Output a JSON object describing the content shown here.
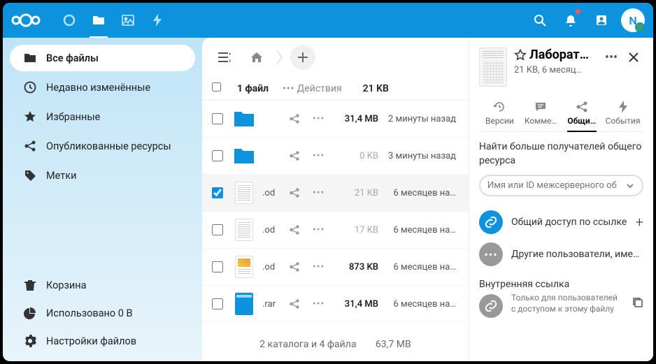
{
  "topbar": {
    "avatar_letter": "N"
  },
  "sidebar": {
    "items": [
      {
        "label": "Все файлы"
      },
      {
        "label": "Недавно изменённые"
      },
      {
        "label": "Избранные"
      },
      {
        "label": "Опубликованные ресурсы"
      },
      {
        "label": "Метки"
      }
    ],
    "trash": "Корзина",
    "quota": "Использовано 0 B",
    "settings": "Настройки файлов"
  },
  "header": {
    "count": "1 файл",
    "actions": "Действия",
    "size": "21 KB"
  },
  "files": [
    {
      "name": "",
      "ext": "",
      "size": "31,4 MB",
      "date": "2 минуты назад",
      "selected": false,
      "type": "folder",
      "dim": false
    },
    {
      "name": "",
      "ext": "",
      "size": "0 KB",
      "date": "3 минуты назад",
      "selected": false,
      "type": "folder",
      "dim": true
    },
    {
      "name": "",
      "ext": ".od",
      "size": "21 KB",
      "date": "6 месяцев на…",
      "selected": true,
      "type": "doc",
      "dim": true
    },
    {
      "name": "",
      "ext": ".od",
      "size": "17 KB",
      "date": "6 месяцев на…",
      "selected": false,
      "type": "doc",
      "dim": true
    },
    {
      "name": "",
      "ext": ".od",
      "size": "873 KB",
      "date": "6 месяцев на…",
      "selected": false,
      "type": "doc2",
      "dim": false
    },
    {
      "name": "",
      "ext": ".rar",
      "size": "31,4 MB",
      "date": "6 месяцев на…",
      "selected": false,
      "type": "archive",
      "dim": false
    }
  ],
  "footer": {
    "summary": "2 каталога и 4 файла",
    "total": "63,7 MB"
  },
  "details": {
    "title": "Лаборат…",
    "meta": "21 KB, 6 месяц…",
    "tabs": [
      {
        "label": "Версии"
      },
      {
        "label": "Комме…"
      },
      {
        "label": "Общи…"
      },
      {
        "label": "События"
      }
    ],
    "sharing": {
      "desc": "Найти больше получателей общего ресурса",
      "placeholder": "Имя или ID межсерверного об",
      "link": "Общий доступ по ссылке",
      "others": "Другие пользователи, имеющие до",
      "internal_title": "Внутренняя ссылка",
      "internal_sub": "Только для пользователей с доступом к этому файлу"
    }
  }
}
